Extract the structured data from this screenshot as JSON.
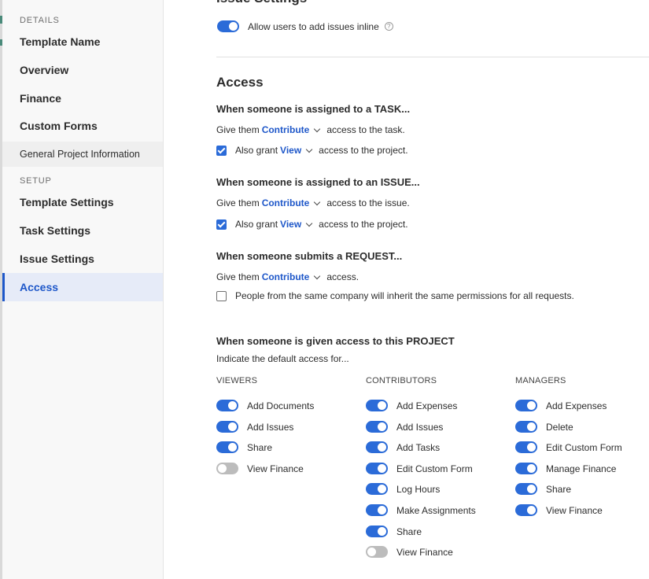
{
  "sidebar": {
    "details_heading": "DETAILS",
    "setup_heading": "SETUP",
    "details_items": [
      "Template Name",
      "Overview",
      "Finance",
      "Custom Forms"
    ],
    "sub_item": "General Project Information",
    "setup_items": [
      "Template Settings",
      "Task Settings",
      "Issue Settings",
      "Access"
    ],
    "active": "Access"
  },
  "issue_settings": {
    "title_partial": "Issue Settings",
    "inline_toggle_label": "Allow users to add issues inline",
    "inline_toggle_on": true
  },
  "access": {
    "title": "Access",
    "task": {
      "heading": "When someone is assigned to a TASK...",
      "give_prefix": "Give them",
      "give_level": "Contribute",
      "give_suffix": "access to the task.",
      "also_checked": true,
      "also_prefix": "Also grant",
      "also_level": "View",
      "also_suffix": "access to the project."
    },
    "issue": {
      "heading": "When someone is assigned to an ISSUE...",
      "give_prefix": "Give them",
      "give_level": "Contribute",
      "give_suffix": "access to the issue.",
      "also_checked": true,
      "also_prefix": "Also grant",
      "also_level": "View",
      "also_suffix": "access to the project."
    },
    "request": {
      "heading": "When someone submits a REQUEST...",
      "give_prefix": "Give them",
      "give_level": "Contribute",
      "give_suffix": "access.",
      "inherit_checked": false,
      "inherit_label": "People from the same company will inherit the same permissions for all requests."
    },
    "project": {
      "heading": "When someone is given access to this PROJECT",
      "subheading": "Indicate the default access for...",
      "columns": [
        {
          "title": "VIEWERS",
          "items": [
            {
              "label": "Add Documents",
              "on": true
            },
            {
              "label": "Add Issues",
              "on": true
            },
            {
              "label": "Share",
              "on": true
            },
            {
              "label": "View Finance",
              "on": false
            }
          ]
        },
        {
          "title": "CONTRIBUTORS",
          "items": [
            {
              "label": "Add Expenses",
              "on": true
            },
            {
              "label": "Add Issues",
              "on": true
            },
            {
              "label": "Add Tasks",
              "on": true
            },
            {
              "label": "Edit Custom Form",
              "on": true
            },
            {
              "label": "Log Hours",
              "on": true
            },
            {
              "label": "Make Assignments",
              "on": true
            },
            {
              "label": "Share",
              "on": true
            },
            {
              "label": "View Finance",
              "on": false
            }
          ]
        },
        {
          "title": "MANAGERS",
          "items": [
            {
              "label": "Add Expenses",
              "on": true
            },
            {
              "label": "Delete",
              "on": true
            },
            {
              "label": "Edit Custom Form",
              "on": true
            },
            {
              "label": "Manage Finance",
              "on": true
            },
            {
              "label": "Share",
              "on": true
            },
            {
              "label": "View Finance",
              "on": true
            }
          ]
        }
      ]
    }
  },
  "colors": {
    "accent": "#2b6bd8",
    "link": "#1e57c9",
    "toggle_off": "#bcbcbc",
    "sidebar_bg": "#f8f8f8",
    "active_bg": "#e6ebf8"
  }
}
